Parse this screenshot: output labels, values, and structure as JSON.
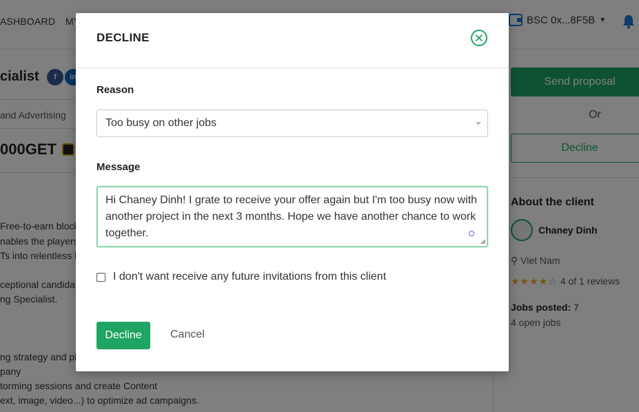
{
  "topbar": {
    "nav": [
      "ASHBOARD",
      "MY"
    ],
    "wallet_label": "BSC 0x...8F5B",
    "icons": [
      "wallet-icon",
      "chevron-down-icon",
      "bell-icon"
    ]
  },
  "job": {
    "title": "cialist",
    "social": [
      "f",
      "in"
    ],
    "category": "and Advertising",
    "budget": "000GET",
    "body_lines": [
      "Free-to-earn block",
      "nables the players",
      "Ts into relentless b",
      "ceptional candida",
      "ng Specialist.",
      "ng strategy and pla",
      "pany",
      "torming sessions and create Content",
      "ext, image, video...) to optimize ad campaigns."
    ]
  },
  "sidebar": {
    "send_proposal": "Send proposal",
    "or": "Or",
    "decline": "Decline",
    "about_heading": "About the client",
    "client_name": "Chaney Dinh",
    "country": "Viet Nam",
    "rating": 4,
    "rating_max": 5,
    "reviews_text": "4 of 1 reviews",
    "jobs_posted_label": "Jobs posted:",
    "jobs_posted_value": "7",
    "open_jobs": "4 open jobs"
  },
  "modal": {
    "title": "DECLINE",
    "reason_label": "Reason",
    "reason_value": "Too busy on other jobs",
    "message_label": "Message",
    "message_value": "Hi Chaney Dinh! I grate to receive your offer again but I'm too busy now with another project in the next 3 months. Hope we have another chance to work together.",
    "checkbox_label": "I don't want receive any future invitations from this client",
    "checkbox_checked": false,
    "decline_button": "Decline",
    "cancel_button": "Cancel",
    "accent_color": "#1fa463"
  }
}
